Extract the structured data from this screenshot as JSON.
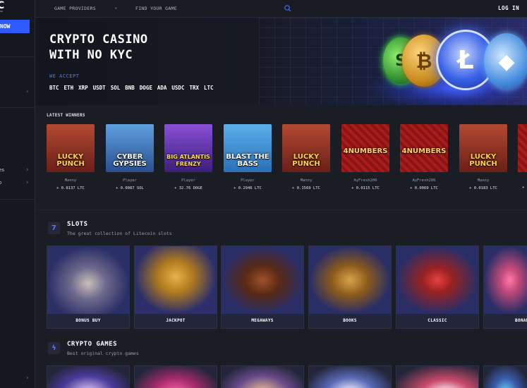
{
  "sidebar": {
    "logo": "C",
    "cta_label": "NOW",
    "items": [
      {
        "label": "es"
      },
      {
        "label": "p"
      }
    ]
  },
  "topbar": {
    "providers_label": "GAME PROVIDERS",
    "search_placeholder": "FIND YOUR GAME",
    "login_label": "LOG IN"
  },
  "hero": {
    "title_line1": "CRYPTO CASINO",
    "title_line2": "WITH NO KYC",
    "accept_label": "WE ACCEPT",
    "currencies": [
      "BTC",
      "ETH",
      "XRP",
      "USDT",
      "SOL",
      "BNB",
      "DOGE",
      "ADA",
      "USDC",
      "TRX",
      "LTC"
    ]
  },
  "latest_winners": {
    "label": "LATEST WINNERS",
    "items": [
      {
        "game": "LUCKY PUNCH",
        "player": "Manny",
        "amount": "+ 0.8137 LTC",
        "bg": "#7a2a22"
      },
      {
        "game": "CYBER GYPSIES",
        "player": "Player",
        "amount": "+ 0.0087 SOL",
        "bg": "#3a6fb5"
      },
      {
        "game": "BIG ATLANTIS FRENZY",
        "player": "Player",
        "amount": "+ 32.76 DOGE",
        "bg": "#6b3fa8"
      },
      {
        "game": "BLAST THE BASS",
        "player": "Player",
        "amount": "+ 0.2946 LTC",
        "bg": "#2d7ec9"
      },
      {
        "game": "LUCKY PUNCH",
        "player": "Manny",
        "amount": "+ 0.1569 LTC",
        "bg": "#7a2a22"
      },
      {
        "game": "4NUMBERS",
        "player": "AyFresh206",
        "amount": "+ 0.0115 LTC",
        "bg": "#9b1c1c"
      },
      {
        "game": "4NUMBERS",
        "player": "AyFresh206",
        "amount": "+ 0.0069 LTC",
        "bg": "#9b1c1c"
      },
      {
        "game": "LUCKY PUNCH",
        "player": "Manny",
        "amount": "+ 0.0183 LTC",
        "bg": "#7a2a22"
      }
    ],
    "partial_amount": "+"
  },
  "slots": {
    "title": "SLOTS",
    "subtitle": "The great collection of Litecoin slots",
    "icon": "7",
    "tiles": [
      {
        "label": "BONUS BUY"
      },
      {
        "label": "JACKPOT"
      },
      {
        "label": "MEGAWAYS"
      },
      {
        "label": "BOOKS"
      },
      {
        "label": "CLASSIC"
      },
      {
        "label": "BONAN"
      }
    ]
  },
  "crypto_games": {
    "title": "CRYPTO GAMES",
    "subtitle": "Best original crypto games",
    "icon": "lightning-icon"
  },
  "colors": {
    "accent": "#2f5bff",
    "background": "#1b1d25"
  }
}
